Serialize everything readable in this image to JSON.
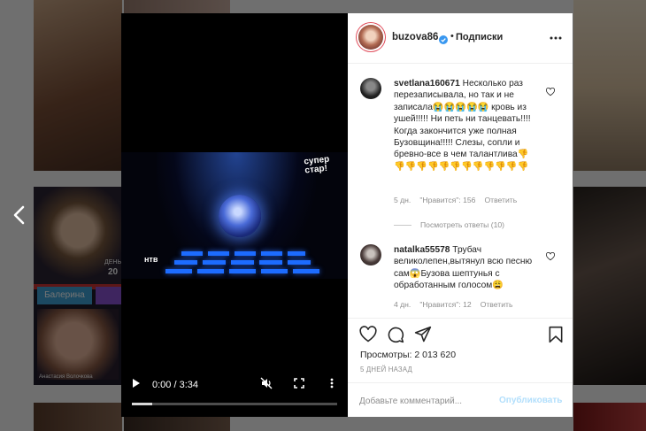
{
  "post": {
    "username": "buzova86",
    "follow_label": "Подписки",
    "bullet": "•",
    "views_label": "Просмотры:",
    "views_value": "2 013 620",
    "date": "5 ДНЕЙ НАЗАД"
  },
  "video": {
    "time": "0:00 / 3:34",
    "progress": 0.1,
    "logo_top": "супер\nстар!",
    "logo_bottom": "нтв"
  },
  "comments": [
    {
      "user": "svetlana160671",
      "text": "Несколько раз перезаписывала, но так и не записала😭😭😭😭😭 кровь из ушей!!!!! Ни петь ни танцевать!!!! Когда закончится уже полная Бузовщина!!!!! Слезы, сопли и бревно-все в чем талантлива👎👎👎👎👎👎👎👎👎👎👎👎👎",
      "age": "5 дн.",
      "likes": "\"Нравится\": 156",
      "reply": "Ответить"
    },
    {
      "user": "natalka55578",
      "text": "Трубач великолепен,вытянул всю песню сам😱Бузова шептунья с обработанным голосом😩",
      "age": "4 дн.",
      "likes": "\"Нравится\": 12",
      "reply": "Ответить"
    }
  ],
  "view_replies": "Посмотреть ответы (10)",
  "add_comment": {
    "placeholder": "Добавьте комментарий...",
    "publish": "Опубликовать"
  },
  "background": {
    "tile_label": "Балерина",
    "tile_caption": "Анастасия Волочкова",
    "tile_day": "ДЕНЬ",
    "tile_number": "20"
  },
  "colors": {
    "verified": "#3897f0",
    "publish_disabled": "#b2dffc",
    "meta_text": "#8e8e8e"
  },
  "icons": [
    "chevron-left-icon",
    "play-icon",
    "mute-icon",
    "fullscreen-icon",
    "more-vertical-icon",
    "verified-icon",
    "options-icon",
    "heart-icon",
    "comment-icon",
    "share-icon",
    "bookmark-icon"
  ]
}
